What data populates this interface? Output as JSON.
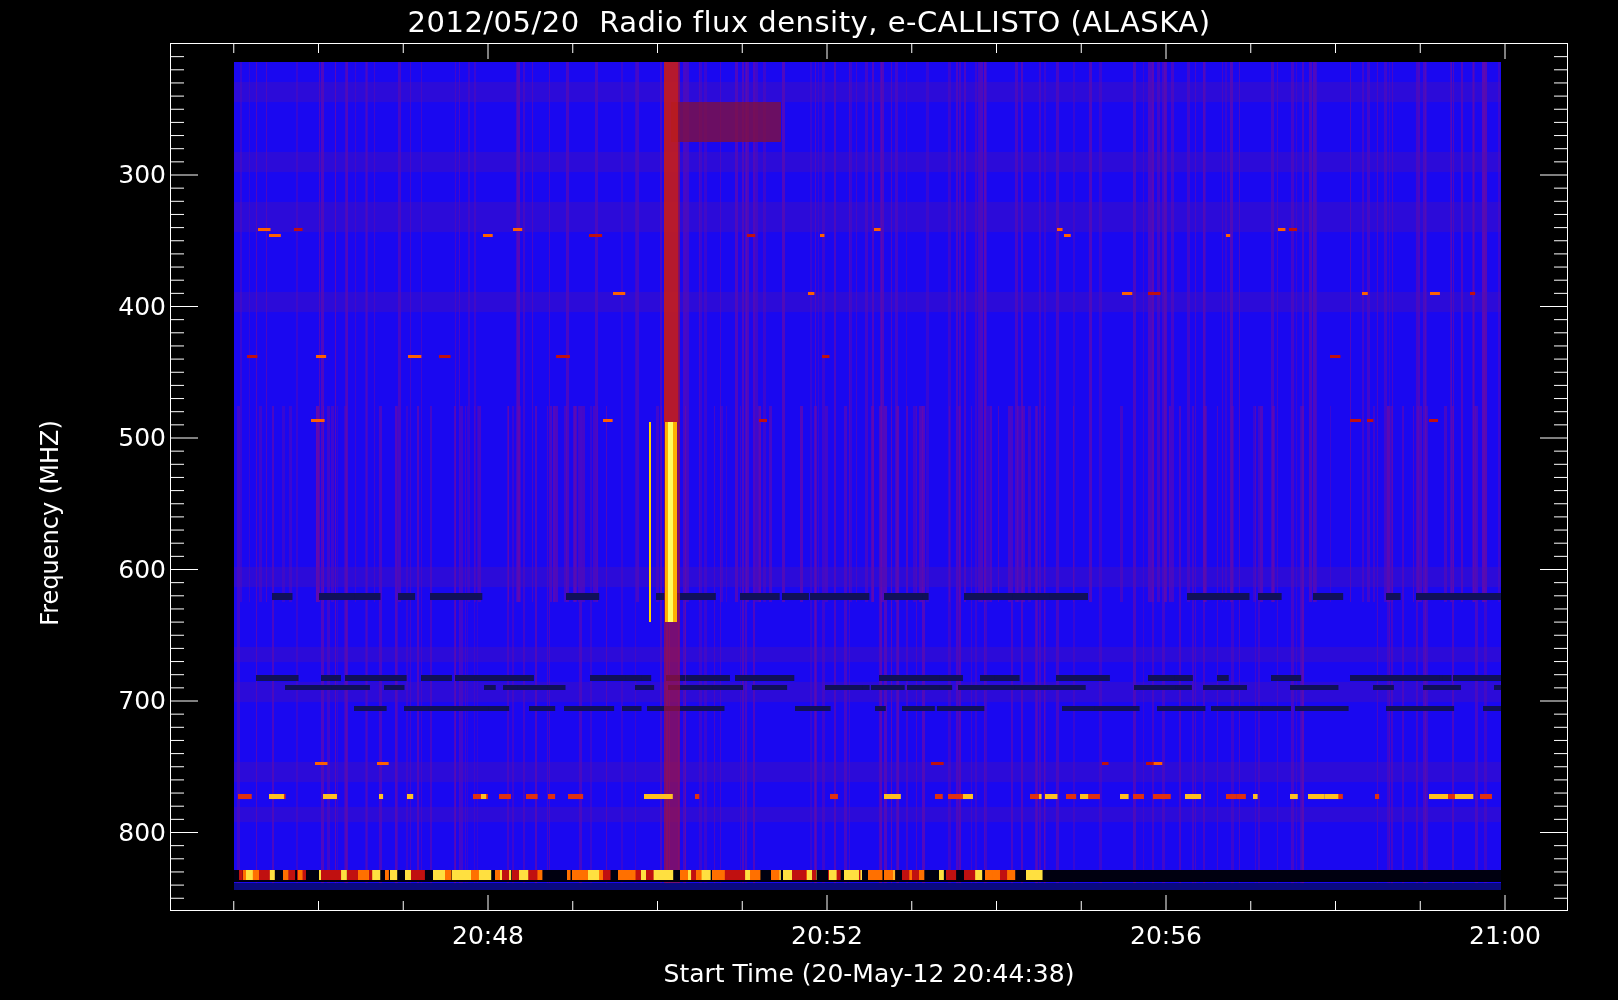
{
  "title": "2012/05/20  Radio flux density, e-CALLISTO (ALASKA)",
  "y_axis": {
    "label": "Frequency (MHZ)",
    "ticks": [
      "300",
      "400",
      "500",
      "600",
      "700",
      "800"
    ]
  },
  "x_axis": {
    "label": "Start Time (20-May-12 20:44:38)",
    "ticks": [
      "20:48",
      "20:52",
      "20:56",
      "21:00"
    ]
  }
}
